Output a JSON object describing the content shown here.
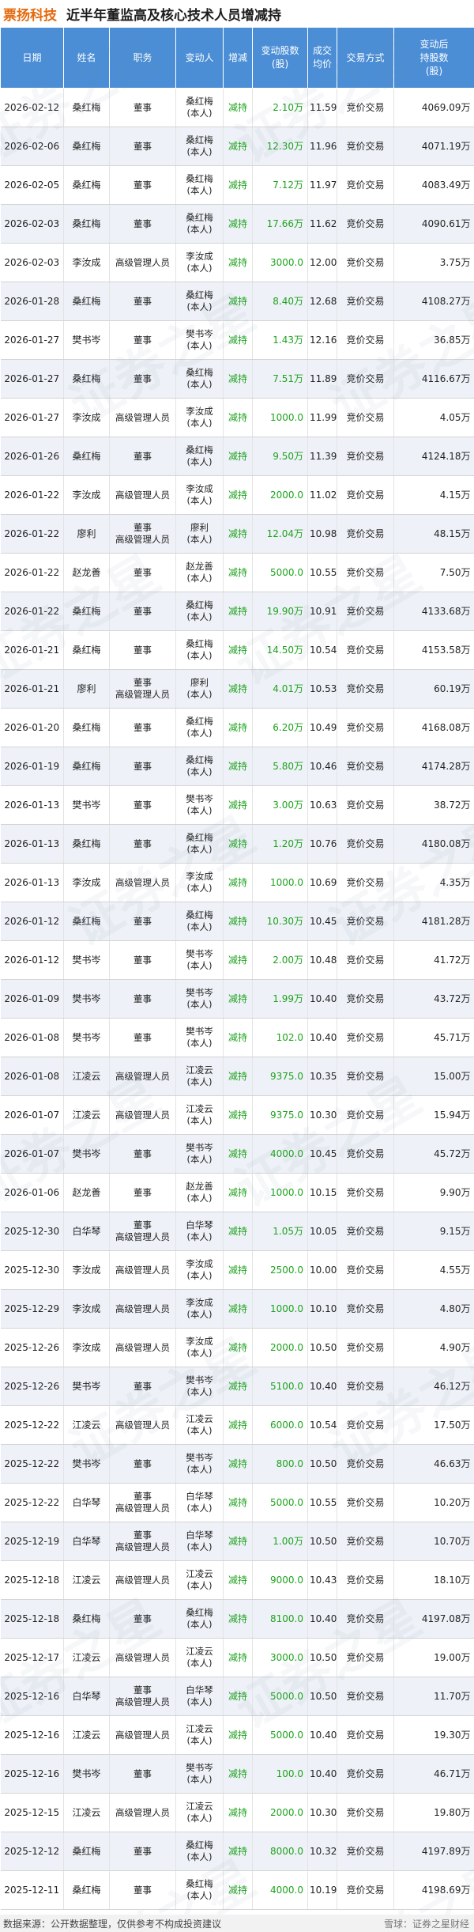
{
  "header": {
    "company": "票扬科技",
    "title": "近半年董监高及核心技术人员增减持"
  },
  "columns": [
    "日期",
    "姓名",
    "职务",
    "变动人",
    "增减",
    "变动股数\n(股)",
    "成交\n均价",
    "交易方式",
    "变动后\n持股数\n(股)"
  ],
  "rows": [
    {
      "date": "2026-02-12",
      "name": "桑红梅",
      "role": "董事",
      "changer": "桑红梅\n(本人)",
      "dir": "减持",
      "amount": "2.10万",
      "price": "11.59",
      "method": "竞价交易",
      "after": "4069.09万"
    },
    {
      "date": "2026-02-06",
      "name": "桑红梅",
      "role": "董事",
      "changer": "桑红梅\n(本人)",
      "dir": "减持",
      "amount": "12.30万",
      "price": "11.96",
      "method": "竞价交易",
      "after": "4071.19万"
    },
    {
      "date": "2026-02-05",
      "name": "桑红梅",
      "role": "董事",
      "changer": "桑红梅\n(本人)",
      "dir": "减持",
      "amount": "7.12万",
      "price": "11.97",
      "method": "竞价交易",
      "after": "4083.49万"
    },
    {
      "date": "2026-02-03",
      "name": "桑红梅",
      "role": "董事",
      "changer": "桑红梅\n(本人)",
      "dir": "减持",
      "amount": "17.66万",
      "price": "11.62",
      "method": "竞价交易",
      "after": "4090.61万"
    },
    {
      "date": "2026-02-03",
      "name": "李汝成",
      "role": "高级管理人员",
      "changer": "李汝成\n(本人)",
      "dir": "减持",
      "amount": "3000.0",
      "price": "12.00",
      "method": "竞价交易",
      "after": "3.75万"
    },
    {
      "date": "2026-01-28",
      "name": "桑红梅",
      "role": "董事",
      "changer": "桑红梅\n(本人)",
      "dir": "减持",
      "amount": "8.40万",
      "price": "12.68",
      "method": "竞价交易",
      "after": "4108.27万"
    },
    {
      "date": "2026-01-27",
      "name": "樊书岑",
      "role": "董事",
      "changer": "樊书岑\n(本人)",
      "dir": "减持",
      "amount": "1.43万",
      "price": "12.16",
      "method": "竞价交易",
      "after": "36.85万"
    },
    {
      "date": "2026-01-27",
      "name": "桑红梅",
      "role": "董事",
      "changer": "桑红梅\n(本人)",
      "dir": "减持",
      "amount": "7.51万",
      "price": "11.89",
      "method": "竞价交易",
      "after": "4116.67万"
    },
    {
      "date": "2026-01-27",
      "name": "李汝成",
      "role": "高级管理人员",
      "changer": "李汝成\n(本人)",
      "dir": "减持",
      "amount": "1000.0",
      "price": "11.99",
      "method": "竞价交易",
      "after": "4.05万"
    },
    {
      "date": "2026-01-26",
      "name": "桑红梅",
      "role": "董事",
      "changer": "桑红梅\n(本人)",
      "dir": "减持",
      "amount": "9.50万",
      "price": "11.39",
      "method": "竞价交易",
      "after": "4124.18万"
    },
    {
      "date": "2026-01-22",
      "name": "李汝成",
      "role": "高级管理人员",
      "changer": "李汝成\n(本人)",
      "dir": "减持",
      "amount": "2000.0",
      "price": "11.02",
      "method": "竞价交易",
      "after": "4.15万"
    },
    {
      "date": "2026-01-22",
      "name": "廖利",
      "role": "董事\n高级管理人员",
      "changer": "廖利\n(本人)",
      "dir": "减持",
      "amount": "12.04万",
      "price": "10.98",
      "method": "竞价交易",
      "after": "48.15万"
    },
    {
      "date": "2026-01-22",
      "name": "赵龙善",
      "role": "董事",
      "changer": "赵龙善\n(本人)",
      "dir": "减持",
      "amount": "5000.0",
      "price": "10.55",
      "method": "竞价交易",
      "after": "7.50万"
    },
    {
      "date": "2026-01-22",
      "name": "桑红梅",
      "role": "董事",
      "changer": "桑红梅\n(本人)",
      "dir": "减持",
      "amount": "19.90万",
      "price": "10.91",
      "method": "竞价交易",
      "after": "4133.68万"
    },
    {
      "date": "2026-01-21",
      "name": "桑红梅",
      "role": "董事",
      "changer": "桑红梅\n(本人)",
      "dir": "减持",
      "amount": "14.50万",
      "price": "10.54",
      "method": "竞价交易",
      "after": "4153.58万"
    },
    {
      "date": "2026-01-21",
      "name": "廖利",
      "role": "董事\n高级管理人员",
      "changer": "廖利\n(本人)",
      "dir": "减持",
      "amount": "4.01万",
      "price": "10.53",
      "method": "竞价交易",
      "after": "60.19万"
    },
    {
      "date": "2026-01-20",
      "name": "桑红梅",
      "role": "董事",
      "changer": "桑红梅\n(本人)",
      "dir": "减持",
      "amount": "6.20万",
      "price": "10.49",
      "method": "竞价交易",
      "after": "4168.08万"
    },
    {
      "date": "2026-01-19",
      "name": "桑红梅",
      "role": "董事",
      "changer": "桑红梅\n(本人)",
      "dir": "减持",
      "amount": "5.80万",
      "price": "10.46",
      "method": "竞价交易",
      "after": "4174.28万"
    },
    {
      "date": "2026-01-13",
      "name": "樊书岑",
      "role": "董事",
      "changer": "樊书岑\n(本人)",
      "dir": "减持",
      "amount": "3.00万",
      "price": "10.63",
      "method": "竞价交易",
      "after": "38.72万"
    },
    {
      "date": "2026-01-13",
      "name": "桑红梅",
      "role": "董事",
      "changer": "桑红梅\n(本人)",
      "dir": "减持",
      "amount": "1.20万",
      "price": "10.76",
      "method": "竞价交易",
      "after": "4180.08万"
    },
    {
      "date": "2026-01-13",
      "name": "李汝成",
      "role": "高级管理人员",
      "changer": "李汝成\n(本人)",
      "dir": "减持",
      "amount": "1000.0",
      "price": "10.69",
      "method": "竞价交易",
      "after": "4.35万"
    },
    {
      "date": "2026-01-12",
      "name": "桑红梅",
      "role": "董事",
      "changer": "桑红梅\n(本人)",
      "dir": "减持",
      "amount": "10.30万",
      "price": "10.45",
      "method": "竞价交易",
      "after": "4181.28万"
    },
    {
      "date": "2026-01-12",
      "name": "樊书岑",
      "role": "董事",
      "changer": "樊书岑\n(本人)",
      "dir": "减持",
      "amount": "2.00万",
      "price": "10.48",
      "method": "竞价交易",
      "after": "41.72万"
    },
    {
      "date": "2026-01-09",
      "name": "樊书岑",
      "role": "董事",
      "changer": "樊书岑\n(本人)",
      "dir": "减持",
      "amount": "1.99万",
      "price": "10.40",
      "method": "竞价交易",
      "after": "43.72万"
    },
    {
      "date": "2026-01-08",
      "name": "樊书岑",
      "role": "董事",
      "changer": "樊书岑\n(本人)",
      "dir": "减持",
      "amount": "102.0",
      "price": "10.40",
      "method": "竞价交易",
      "after": "45.71万"
    },
    {
      "date": "2026-01-08",
      "name": "江凌云",
      "role": "高级管理人员",
      "changer": "江凌云\n(本人)",
      "dir": "减持",
      "amount": "9375.0",
      "price": "10.35",
      "method": "竞价交易",
      "after": "15.00万"
    },
    {
      "date": "2026-01-07",
      "name": "江凌云",
      "role": "高级管理人员",
      "changer": "江凌云\n(本人)",
      "dir": "减持",
      "amount": "9375.0",
      "price": "10.30",
      "method": "竞价交易",
      "after": "15.94万"
    },
    {
      "date": "2026-01-07",
      "name": "樊书岑",
      "role": "董事",
      "changer": "樊书岑\n(本人)",
      "dir": "减持",
      "amount": "4000.0",
      "price": "10.45",
      "method": "竞价交易",
      "after": "45.72万"
    },
    {
      "date": "2026-01-06",
      "name": "赵龙善",
      "role": "董事",
      "changer": "赵龙善\n(本人)",
      "dir": "减持",
      "amount": "1000.0",
      "price": "10.15",
      "method": "竞价交易",
      "after": "9.90万"
    },
    {
      "date": "2025-12-30",
      "name": "白华琴",
      "role": "董事\n高级管理人员",
      "changer": "白华琴\n(本人)",
      "dir": "减持",
      "amount": "1.05万",
      "price": "10.05",
      "method": "竞价交易",
      "after": "9.15万"
    },
    {
      "date": "2025-12-30",
      "name": "李汝成",
      "role": "高级管理人员",
      "changer": "李汝成\n(本人)",
      "dir": "减持",
      "amount": "2500.0",
      "price": "10.00",
      "method": "竞价交易",
      "after": "4.55万"
    },
    {
      "date": "2025-12-29",
      "name": "李汝成",
      "role": "高级管理人员",
      "changer": "李汝成\n(本人)",
      "dir": "减持",
      "amount": "1000.0",
      "price": "10.10",
      "method": "竞价交易",
      "after": "4.80万"
    },
    {
      "date": "2025-12-26",
      "name": "李汝成",
      "role": "高级管理人员",
      "changer": "李汝成\n(本人)",
      "dir": "减持",
      "amount": "2000.0",
      "price": "10.50",
      "method": "竞价交易",
      "after": "4.90万"
    },
    {
      "date": "2025-12-26",
      "name": "樊书岑",
      "role": "董事",
      "changer": "樊书岑\n(本人)",
      "dir": "减持",
      "amount": "5100.0",
      "price": "10.40",
      "method": "竞价交易",
      "after": "46.12万"
    },
    {
      "date": "2025-12-22",
      "name": "江凌云",
      "role": "高级管理人员",
      "changer": "江凌云\n(本人)",
      "dir": "减持",
      "amount": "6000.0",
      "price": "10.54",
      "method": "竞价交易",
      "after": "17.50万"
    },
    {
      "date": "2025-12-22",
      "name": "樊书岑",
      "role": "董事",
      "changer": "樊书岑\n(本人)",
      "dir": "减持",
      "amount": "800.0",
      "price": "10.50",
      "method": "竞价交易",
      "after": "46.63万"
    },
    {
      "date": "2025-12-22",
      "name": "白华琴",
      "role": "董事\n高级管理人员",
      "changer": "白华琴\n(本人)",
      "dir": "减持",
      "amount": "5000.0",
      "price": "10.55",
      "method": "竞价交易",
      "after": "10.20万"
    },
    {
      "date": "2025-12-19",
      "name": "白华琴",
      "role": "董事\n高级管理人员",
      "changer": "白华琴\n(本人)",
      "dir": "减持",
      "amount": "1.00万",
      "price": "10.50",
      "method": "竞价交易",
      "after": "10.70万"
    },
    {
      "date": "2025-12-18",
      "name": "江凌云",
      "role": "高级管理人员",
      "changer": "江凌云\n(本人)",
      "dir": "减持",
      "amount": "9000.0",
      "price": "10.43",
      "method": "竞价交易",
      "after": "18.10万"
    },
    {
      "date": "2025-12-18",
      "name": "桑红梅",
      "role": "董事",
      "changer": "桑红梅\n(本人)",
      "dir": "减持",
      "amount": "8100.0",
      "price": "10.40",
      "method": "竞价交易",
      "after": "4197.08万"
    },
    {
      "date": "2025-12-17",
      "name": "江凌云",
      "role": "高级管理人员",
      "changer": "江凌云\n(本人)",
      "dir": "减持",
      "amount": "3000.0",
      "price": "10.50",
      "method": "竞价交易",
      "after": "19.00万"
    },
    {
      "date": "2025-12-16",
      "name": "白华琴",
      "role": "董事\n高级管理人员",
      "changer": "白华琴\n(本人)",
      "dir": "减持",
      "amount": "5000.0",
      "price": "10.50",
      "method": "竞价交易",
      "after": "11.70万"
    },
    {
      "date": "2025-12-16",
      "name": "江凌云",
      "role": "高级管理人员",
      "changer": "江凌云\n(本人)",
      "dir": "减持",
      "amount": "5000.0",
      "price": "10.40",
      "method": "竞价交易",
      "after": "19.30万"
    },
    {
      "date": "2025-12-16",
      "name": "樊书岑",
      "role": "董事",
      "changer": "樊书岑\n(本人)",
      "dir": "减持",
      "amount": "100.0",
      "price": "10.40",
      "method": "竞价交易",
      "after": "46.71万"
    },
    {
      "date": "2025-12-15",
      "name": "江凌云",
      "role": "高级管理人员",
      "changer": "江凌云\n(本人)",
      "dir": "减持",
      "amount": "2000.0",
      "price": "10.30",
      "method": "竞价交易",
      "after": "19.80万"
    },
    {
      "date": "2025-12-12",
      "name": "桑红梅",
      "role": "董事",
      "changer": "桑红梅\n(本人)",
      "dir": "减持",
      "amount": "8000.0",
      "price": "10.32",
      "method": "竞价交易",
      "after": "4197.89万"
    },
    {
      "date": "2025-12-11",
      "name": "桑红梅",
      "role": "董事",
      "changer": "桑红梅\n(本人)",
      "dir": "减持",
      "amount": "4000.0",
      "price": "10.19",
      "method": "竞价交易",
      "after": "4198.69万"
    }
  ],
  "footer": {
    "note": "数据来源：公开数据整理，仅供参考不构成投资建议",
    "brand": "雪球：证券之星财经"
  },
  "watermark": "证券之星",
  "colors": {
    "header_bg": "#4b8ed6",
    "company": "#e4690c",
    "sell": "#1ea31e",
    "alt_row": "#eef1f7"
  }
}
